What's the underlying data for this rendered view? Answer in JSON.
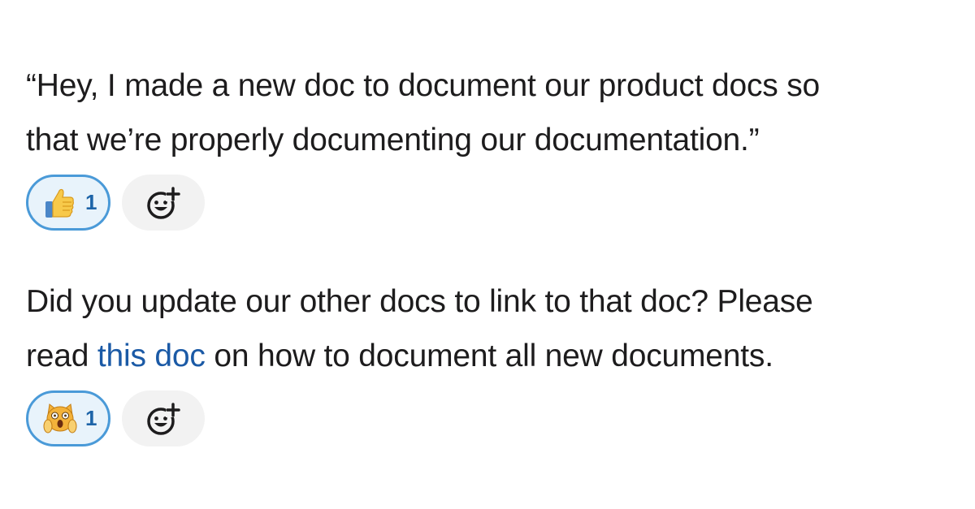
{
  "messages": [
    {
      "lines": [
        "“Hey, I made a new doc to document our product docs so",
        "that we’re properly documenting our documentation.”"
      ],
      "reaction": {
        "emoji": "thumbs-up-icon",
        "count": "1"
      }
    },
    {
      "line1": "Did you update our other docs to link to that doc? Please",
      "line2_before": "read ",
      "line2_link": "this doc",
      "line2_after": " on how to document all new documents.",
      "reaction": {
        "emoji": "screaming-cat-icon",
        "count": "1"
      }
    }
  ],
  "colors": {
    "link": "#1b5aa6",
    "reaction_border": "#4a9ad8",
    "reaction_bg": "#e8f3fb",
    "add_reaction_bg": "#f2f2f2"
  }
}
